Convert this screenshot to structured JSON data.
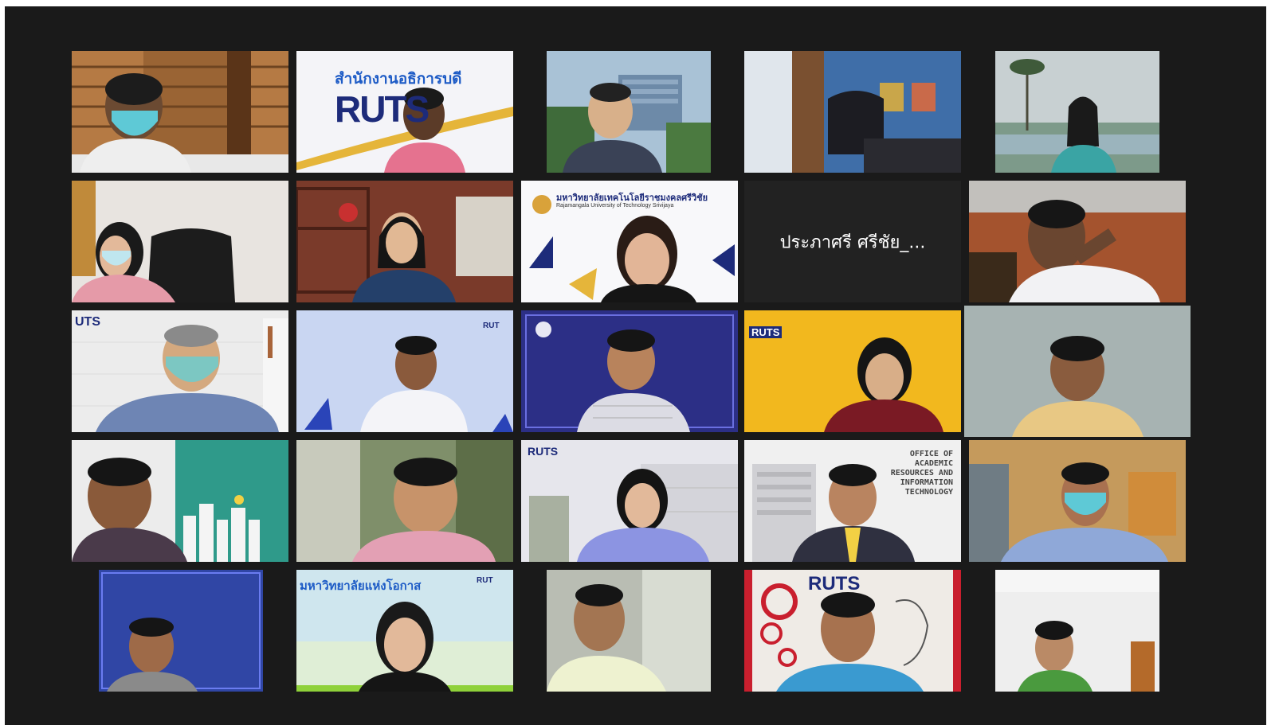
{
  "gallery": {
    "tiles": [
      {
        "id": "t1",
        "bg": "#8b5a2b",
        "label": ""
      },
      {
        "id": "t2",
        "bg": "#f4f4f8",
        "label": "สำนักงานอธิการบดี",
        "brand": "RUTS"
      },
      {
        "id": "t3",
        "bg": "#9fb7c9",
        "label": ""
      },
      {
        "id": "t4",
        "bg": "#3f6ea8",
        "label": ""
      },
      {
        "id": "t5",
        "bg": "#b9c4c8",
        "label": ""
      },
      {
        "id": "t6",
        "bg": "#e8e4e0",
        "label": ""
      },
      {
        "id": "t7",
        "bg": "#7a3a2a",
        "label": ""
      },
      {
        "id": "t8",
        "bg": "#f8f8fa",
        "label": "มหาวิทยาลัยเทคโนโลยีราชมงคลศรีวิชัย",
        "sublabel": "Rajamangala University of Technology Srivijaya"
      },
      {
        "id": "t9",
        "bg": "#222222",
        "name": "ประภาศรี ศรีชัย_..."
      },
      {
        "id": "t10",
        "bg": "#a4532e",
        "label": ""
      },
      {
        "id": "t11",
        "bg": "#ececec",
        "label": "",
        "brand": "UTS"
      },
      {
        "id": "t12",
        "bg": "#b8c9ee",
        "label": "",
        "brand": "RUT"
      },
      {
        "id": "t13",
        "bg": "#2c2f86",
        "label": ""
      },
      {
        "id": "t14",
        "bg": "#f2b81e",
        "label": "",
        "brand": "RUTS"
      },
      {
        "id": "t15",
        "bg": "#a7b3b2",
        "label": ""
      },
      {
        "id": "t16",
        "bg": "#2f9a8a",
        "label": ""
      },
      {
        "id": "t17",
        "bg": "#7f8f6a",
        "label": ""
      },
      {
        "id": "t18",
        "bg": "#e6e6ec",
        "label": "",
        "brand": "RUTS"
      },
      {
        "id": "t19",
        "bg": "#f0f0f0",
        "label": "",
        "office": [
          "OFFICE OF",
          "ACADEMIC",
          "RESOURCES AND",
          "INFORMATION",
          "TECHNOLOGY"
        ]
      },
      {
        "id": "t20",
        "bg": "#c59a5c",
        "label": ""
      },
      {
        "id": "t21",
        "bg": "#3046a5",
        "label": ""
      },
      {
        "id": "t22",
        "bg": "#cfe6ee",
        "label": "มหาวิทยาลัยแห่งโอกาส",
        "brand": "RUT"
      },
      {
        "id": "t23",
        "bg": "#b9bdb3",
        "label": ""
      },
      {
        "id": "t24",
        "bg": "#efebe6",
        "label": "",
        "brand": "RUTS"
      },
      {
        "id": "t25",
        "bg": "#eeeeee",
        "label": ""
      }
    ]
  },
  "colors": {
    "meeting_bg": "#1a1a1a",
    "active_speaker_border": "#cddc39",
    "ruts_navy": "#1d2b7a",
    "gold": "#e5b53a"
  }
}
